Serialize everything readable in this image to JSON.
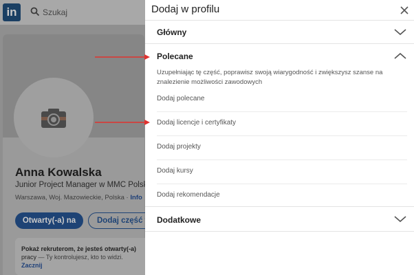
{
  "background": {
    "logo": "in",
    "search_placeholder": "Szukaj",
    "profile": {
      "name": "Anna Kowalska",
      "headline": "Junior Project Manager w MMC Polsk",
      "location": "Warszawa, Woj. Mazowieckie, Polska",
      "location_sep": " · ",
      "location_link": "Info",
      "btn_open": "Otwarty(-a) na",
      "btn_add": "Dodaj część w",
      "info_bold": "Pokaż rekruterom, że jesteś otwarty(-a)",
      "info_rest_a": "pracy",
      "info_rest_b": " — Ty kontrolujesz, kto to widzi.",
      "info_link": "Zacznij"
    }
  },
  "modal": {
    "title": "Dodaj w profilu",
    "sections": {
      "main": {
        "title": "Główny"
      },
      "recommended": {
        "title": "Polecane",
        "description": "Uzupełniając tę część, poprawisz swoją wiarygodność i zwiększysz szanse na znalezienie możliwości zawodowych",
        "items": [
          "Dodaj polecane",
          "Dodaj licencje i certyfikaty",
          "Dodaj projekty",
          "Dodaj kursy",
          "Dodaj rekomendacje"
        ]
      },
      "additional": {
        "title": "Dodatkowe"
      }
    }
  },
  "colors": {
    "annotation_arrow": "#e0322f",
    "linkedin_blue": "#0a66c2",
    "overlay_gray": "#8f8f8f"
  },
  "icons": [
    "search-icon",
    "camera-icon",
    "close-icon",
    "chevron-down-icon",
    "chevron-up-icon"
  ]
}
